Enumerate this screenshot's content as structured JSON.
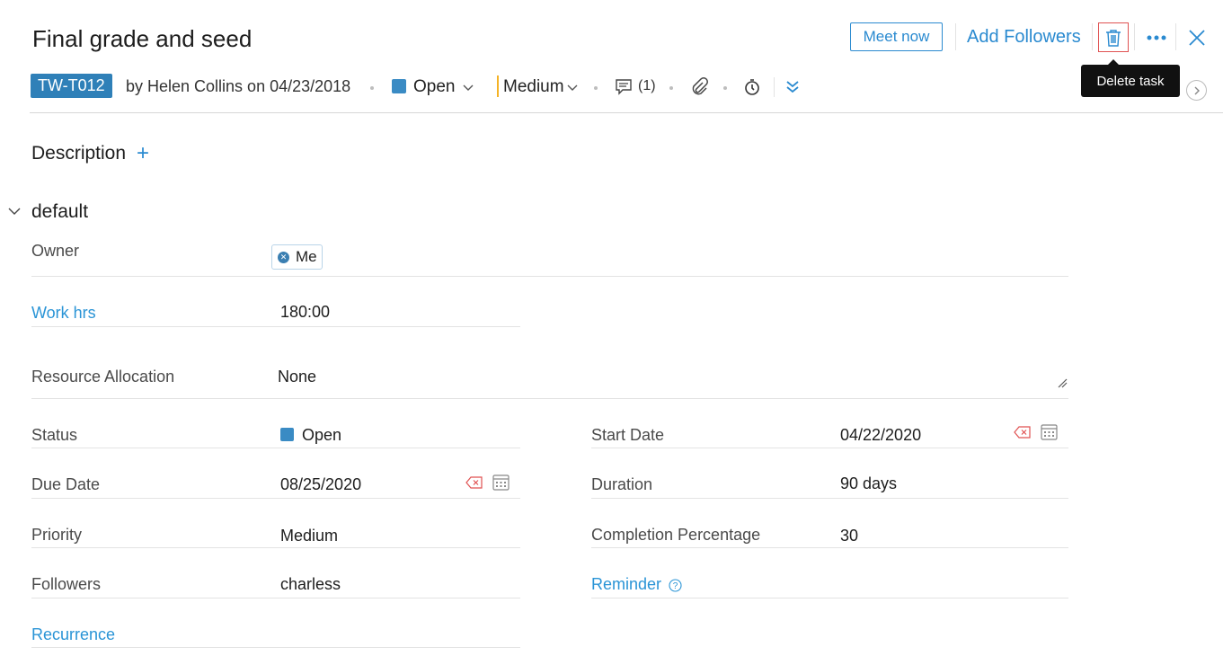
{
  "header": {
    "title": "Final grade and seed",
    "meet_now": "Meet now",
    "add_followers": "Add Followers",
    "tooltip": "Delete task"
  },
  "meta": {
    "task_id": "TW-T012",
    "byline": "by Helen Collins on 04/23/2018",
    "status": "Open",
    "priority": "Medium",
    "comment_count": "(1)"
  },
  "colors": {
    "accent": "#2a8ad0",
    "status_open": "#3a8bc4",
    "priority_medium": "#f5b326",
    "delete_highlight": "#e05252"
  },
  "icons": [
    "trash-icon",
    "more-icon",
    "close-icon",
    "chevron-right-icon",
    "chevron-down-icon",
    "comment-icon",
    "attachment-icon",
    "timer-icon",
    "expand-double-chevron-icon",
    "clear-date-icon",
    "calendar-icon",
    "help-icon"
  ],
  "description": {
    "label": "Description",
    "add": "+"
  },
  "section": {
    "title": "default",
    "fields": {
      "owner": {
        "label": "Owner",
        "chip": "Me"
      },
      "work_hrs": {
        "label": "Work hrs",
        "value": "180:00"
      },
      "resource_allocation": {
        "label": "Resource Allocation",
        "value": "None"
      },
      "status": {
        "label": "Status",
        "value": "Open"
      },
      "start_date": {
        "label": "Start Date",
        "value": "04/22/2020"
      },
      "due_date": {
        "label": "Due Date",
        "value": "08/25/2020"
      },
      "duration": {
        "label": "Duration",
        "value": "90 days"
      },
      "priority": {
        "label": "Priority",
        "value": "Medium"
      },
      "completion": {
        "label": "Completion Percentage",
        "value": "30"
      },
      "followers": {
        "label": "Followers",
        "value": "charless"
      },
      "reminder": {
        "label": "Reminder"
      },
      "recurrence": {
        "label": "Recurrence"
      }
    }
  }
}
